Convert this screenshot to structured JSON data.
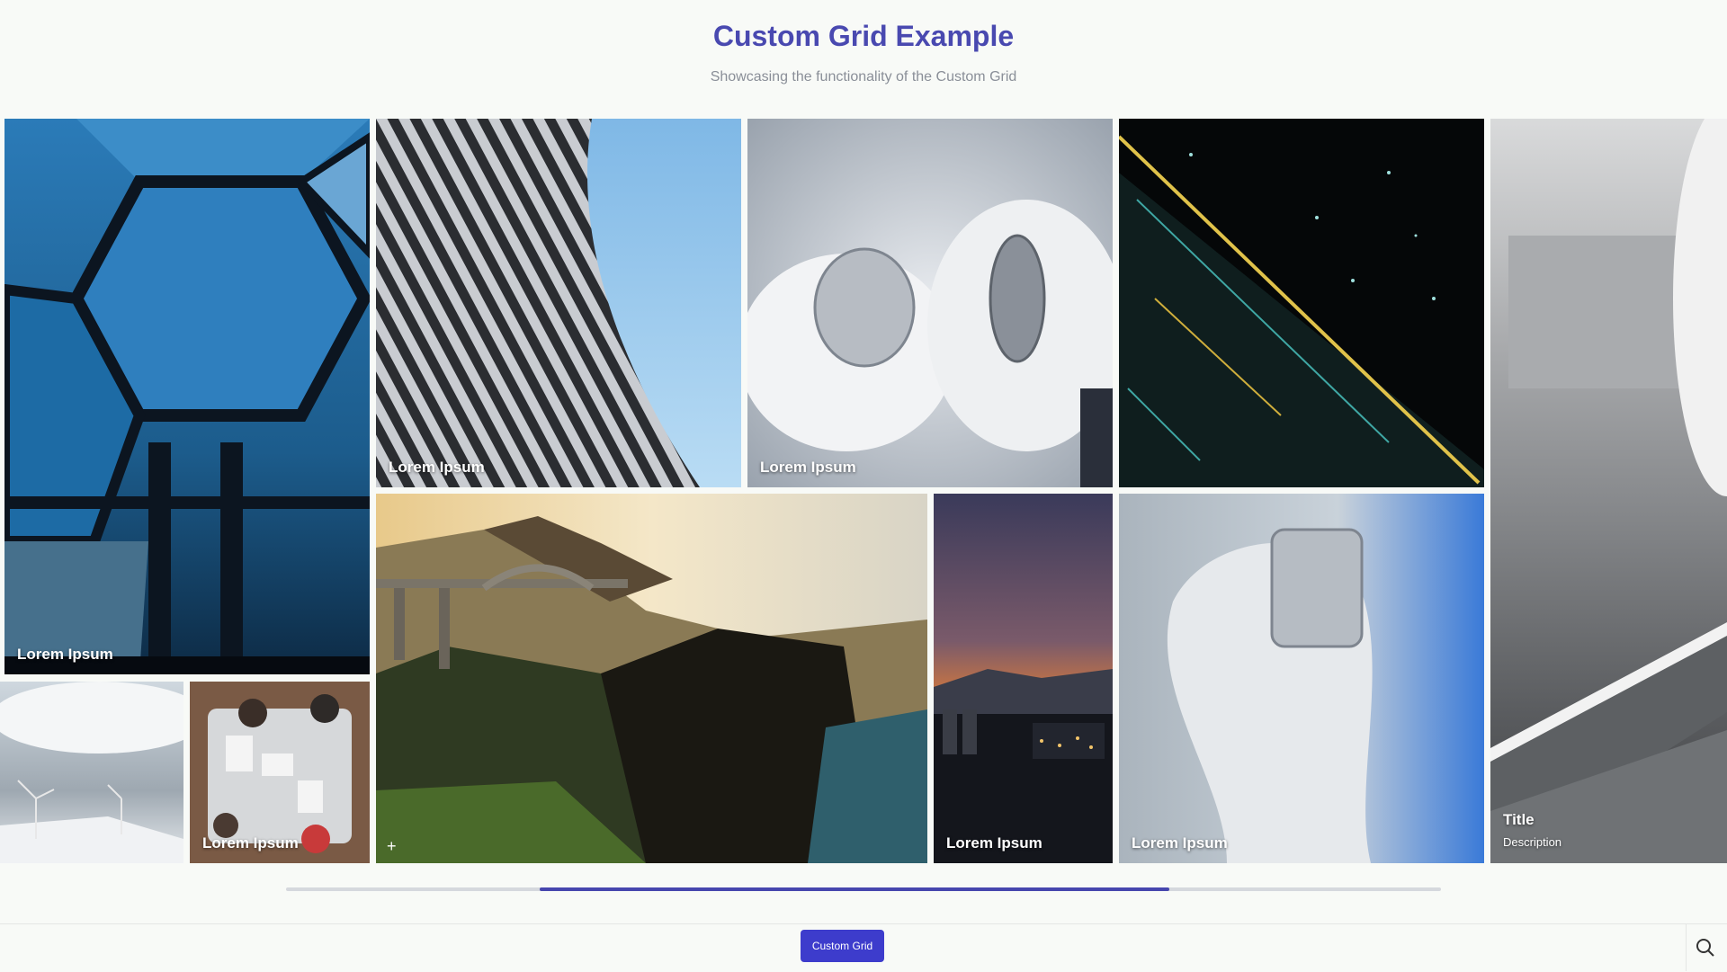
{
  "header": {
    "title": "Custom Grid Example",
    "subtitle": "Showcasing the functionality of the Custom Grid"
  },
  "tiles": {
    "hexagon": {
      "label": "Lorem Ipsum"
    },
    "tower": {
      "label": "Lorem Ipsum"
    },
    "gloves": {
      "label": "Lorem Ipsum"
    },
    "circuit": {
      "label": ""
    },
    "partial": {
      "title": "Title",
      "description": "Description"
    },
    "wind": {
      "label": ""
    },
    "meeting": {
      "label": "Lorem Ipsum"
    },
    "bridge": {
      "label": ""
    },
    "city": {
      "label": "Lorem Ipsum"
    },
    "glove2": {
      "label": "Lorem Ipsum"
    }
  },
  "scrollbar": {
    "thumb_start_fraction": 0.22,
    "thumb_end_fraction": 0.765
  },
  "footer": {
    "button_label": "Custom Grid"
  },
  "colors": {
    "accent": "#4949b0",
    "button": "#3d3ccc",
    "scroll_thumb": "#4646ae"
  },
  "icons": {
    "add": "plus-icon",
    "search": "search-icon"
  }
}
